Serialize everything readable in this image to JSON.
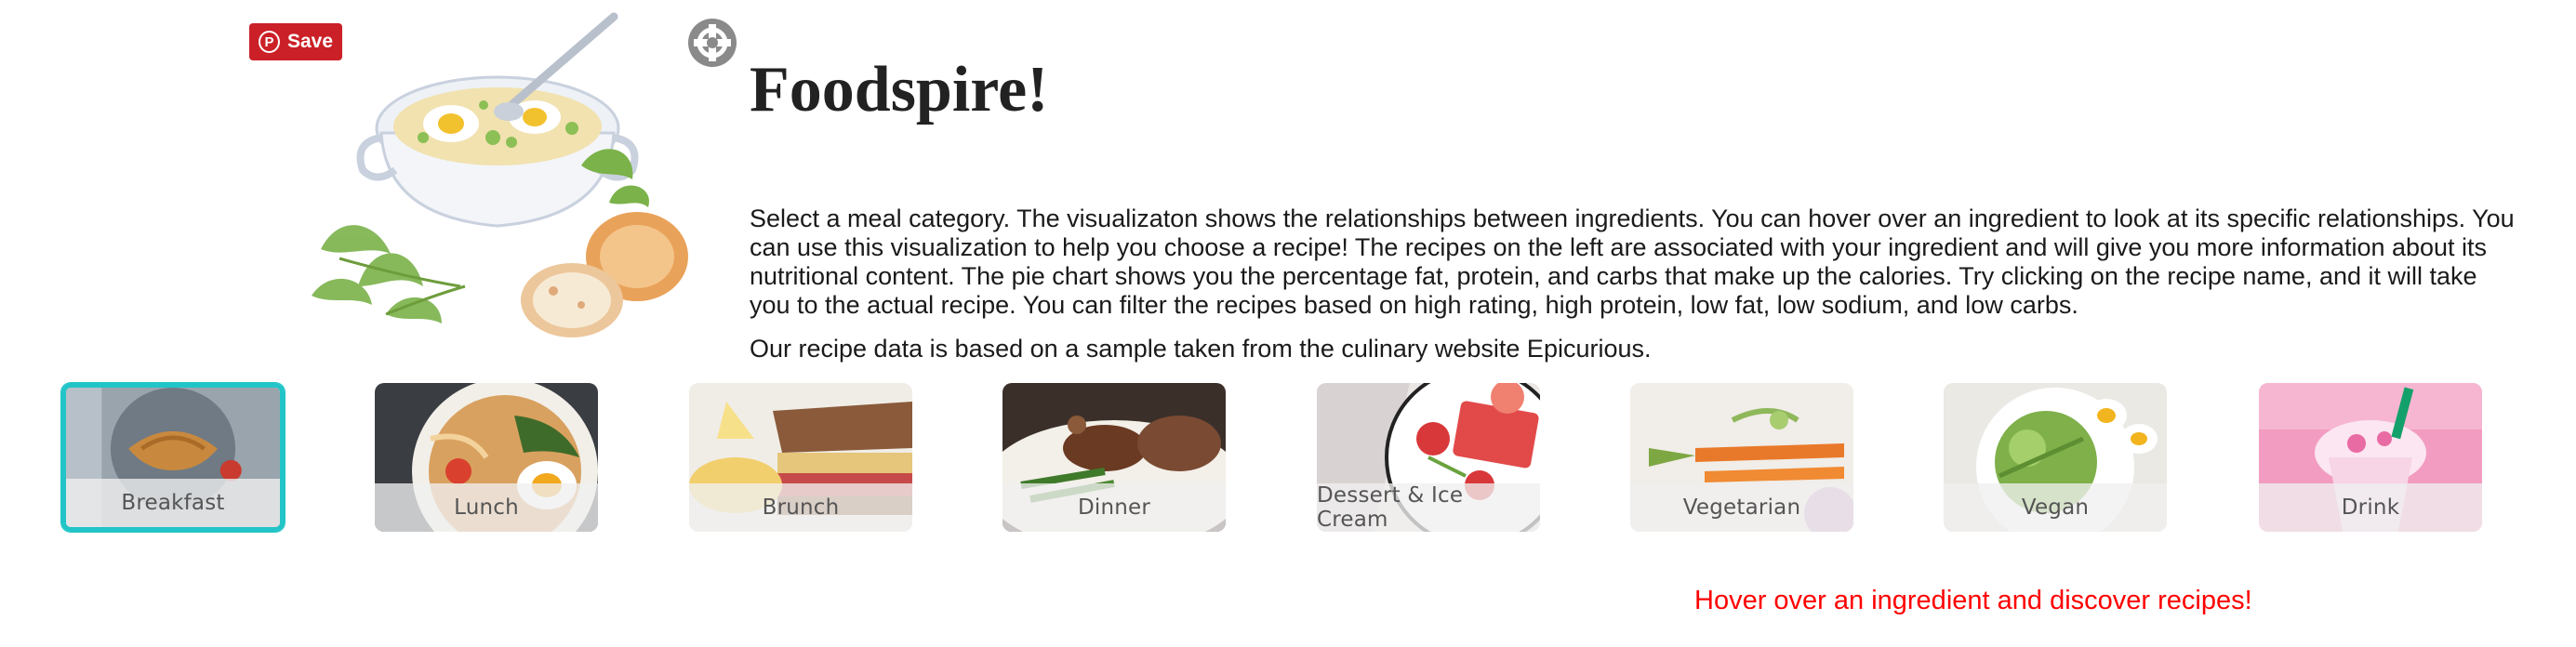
{
  "pin_button": {
    "label": "Save",
    "icon": "pinterest-icon",
    "color": "#cb2027"
  },
  "crosshair": {
    "icon": "crosshair-icon"
  },
  "page": {
    "title": "Foodspire!",
    "description": "Select a meal category. The visualizaton shows the relationships between ingredients. You can hover over an ingredient to look at its specific relationships. You can use this visualization to help you choose a recipe! The recipes on the left are associated with your ingredient and will give you more information about its nutritional content. The pie chart shows you the percentage fat, protein, and carbs that make up the calories. Try clicking on the recipe name, and it will take you to the actual recipe. You can filter the recipes based on high rating, high protein, low fat, low sodium, and low carbs.",
    "source_note": "Our recipe data is based on a sample taken from the culinary website Epicurious."
  },
  "categories": [
    {
      "label": "Breakfast",
      "selected": true
    },
    {
      "label": "Lunch",
      "selected": false
    },
    {
      "label": "Brunch",
      "selected": false
    },
    {
      "label": "Dinner",
      "selected": false
    },
    {
      "label": "Dessert & Ice Cream",
      "selected": false
    },
    {
      "label": "Vegetarian",
      "selected": false
    },
    {
      "label": "Vegan",
      "selected": false
    },
    {
      "label": "Drink",
      "selected": false
    }
  ],
  "hint": "Hover over an ingredient and discover recipes!",
  "colors": {
    "selected_border": "#22c5c7",
    "hint": "#ff0000"
  }
}
